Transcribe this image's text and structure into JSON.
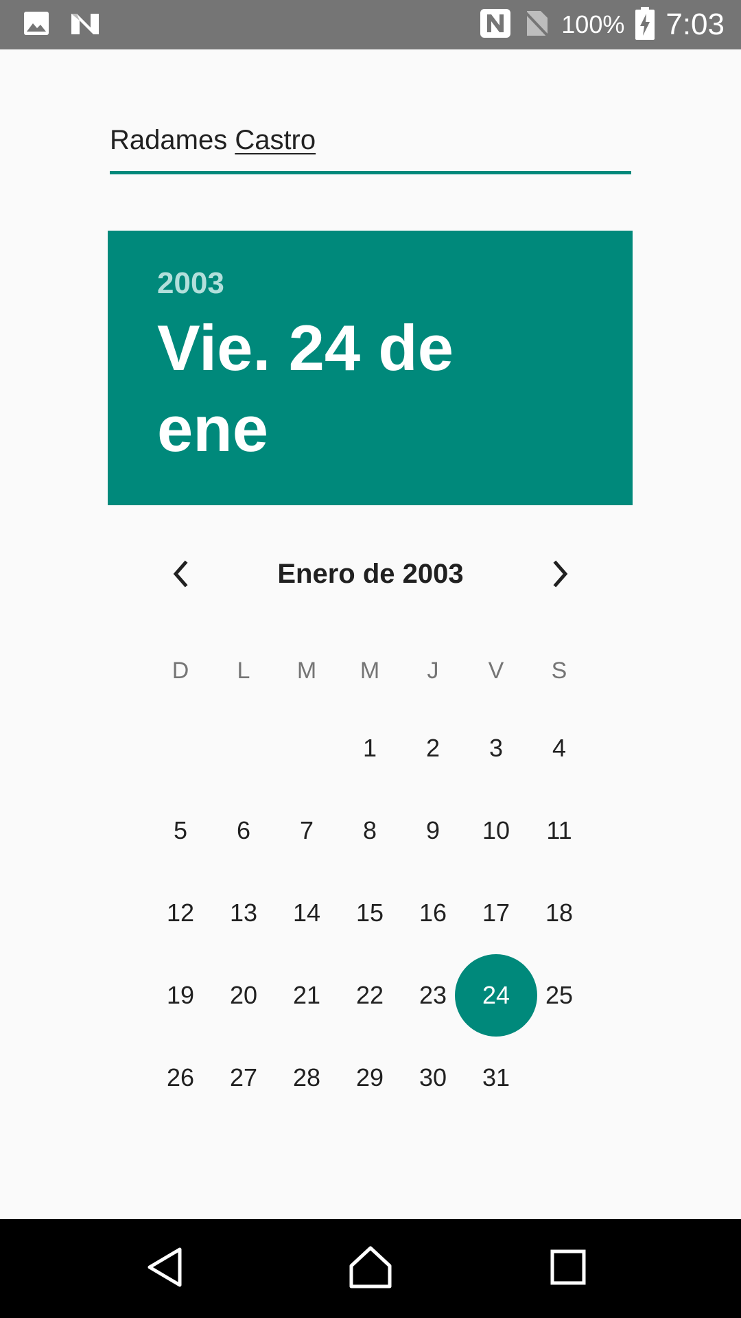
{
  "status_bar": {
    "battery_percent": "100%",
    "time": "7:03",
    "icons": [
      "image-icon",
      "n-logo-icon",
      "nfc-icon",
      "no-sim-icon",
      "battery-charging-icon"
    ]
  },
  "name_field": {
    "first": "Radames ",
    "last": "Castro"
  },
  "header": {
    "year": "2003",
    "date": "Vie. 24 de ene"
  },
  "month_nav": {
    "title": "Enero de 2003",
    "prev_icon": "chevron-left-icon",
    "next_icon": "chevron-right-icon"
  },
  "calendar": {
    "weekdays": [
      "D",
      "L",
      "M",
      "M",
      "J",
      "V",
      "S"
    ],
    "leading_blanks": 3,
    "days": [
      "1",
      "2",
      "3",
      "4",
      "5",
      "6",
      "7",
      "8",
      "9",
      "10",
      "11",
      "12",
      "13",
      "14",
      "15",
      "16",
      "17",
      "18",
      "19",
      "20",
      "21",
      "22",
      "23",
      "24",
      "25",
      "26",
      "27",
      "28",
      "29",
      "30",
      "31"
    ],
    "selected": "24"
  },
  "nav_bar": {
    "icons": [
      "back-icon",
      "home-icon",
      "recents-icon"
    ]
  },
  "colors": {
    "accent": "#00897b",
    "accent_light": "#b2dfdb",
    "status_bar": "#757575",
    "nav_bar": "#000000",
    "background": "#fafafa"
  }
}
